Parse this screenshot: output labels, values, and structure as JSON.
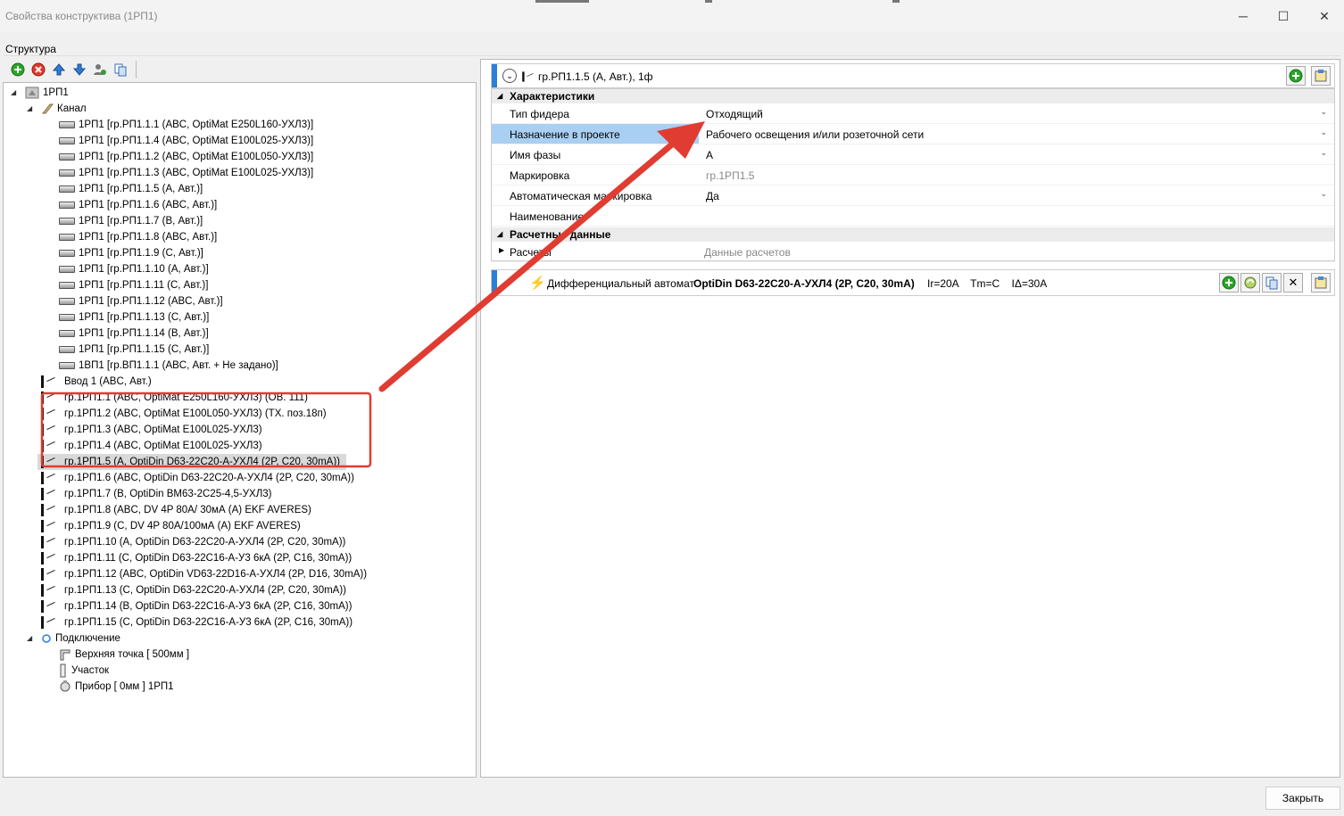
{
  "window": {
    "title": "Свойства конструктива (1РП1)",
    "controls": [
      "─",
      "☐",
      "✕"
    ]
  },
  "structure_label": "Структура",
  "toolbar": {
    "icons": [
      "add-icon",
      "delete-icon",
      "move-up-icon",
      "move-down-icon",
      "user-settings-icon",
      "copy-icon"
    ]
  },
  "tree": {
    "root": "1РП1",
    "channel": "Канал",
    "channel_items": [
      "1РП1 [гр.РП1.1.1 (ABC, OptiMat E250L160-УХЛ3)]",
      "1РП1 [гр.РП1.1.4 (ABC, OptiMat E100L025-УХЛ3)]",
      "1РП1 [гр.РП1.1.2 (ABC, OptiMat E100L050-УХЛ3)]",
      "1РП1 [гр.РП1.1.3 (ABC, OptiMat E100L025-УХЛ3)]",
      "1РП1 [гр.РП1.1.5 (A, Авт.)]",
      "1РП1 [гр.РП1.1.6 (ABC, Авт.)]",
      "1РП1 [гр.РП1.1.7 (B, Авт.)]",
      "1РП1 [гр.РП1.1.8 (ABC, Авт.)]",
      "1РП1 [гр.РП1.1.9 (C, Авт.)]",
      "1РП1 [гр.РП1.1.10 (A, Авт.)]",
      "1РП1 [гр.РП1.1.11 (C, Авт.)]",
      "1РП1 [гр.РП1.1.12 (ABC, Авт.)]",
      "1РП1 [гр.РП1.1.13 (C, Авт.)]",
      "1РП1 [гр.РП1.1.14 (B, Авт.)]",
      "1РП1 [гр.РП1.1.15 (C, Авт.)]",
      "1ВП1 [гр.ВП1.1.1 (ABC, Авт. + Не задано)]"
    ],
    "devices": [
      "Ввод 1 (ABC, Авт.)",
      "гр.1РП1.1 (ABC, OptiMat E250L160-УХЛ3)   (ОВ. 111)",
      "гр.1РП1.2 (ABC, OptiMat E100L050-УХЛ3)   (ТХ. поз.18п)",
      "гр.1РП1.3 (ABC, OptiMat E100L025-УХЛ3)",
      "гр.1РП1.4 (ABC, OptiMat E100L025-УХЛ3)",
      "гр.1РП1.5 (A, OptiDin D63-22C20-A-УХЛ4 (2P, C20, 30mA))",
      "гр.1РП1.6 (ABC, OptiDin D63-22C20-A-УХЛ4 (2P, C20, 30mA))",
      "гр.1РП1.7 (B, OptiDin BM63-2C25-4,5-УХЛ3)",
      "гр.1РП1.8 (ABC, DV 4P  80A/ 30мА (A) EKF AVERES)",
      "гр.1РП1.9 (C, DV 4P  80A/100мА (A) EKF AVERES)",
      "гр.1РП1.10 (A, OptiDin D63-22C20-A-УХЛ4 (2P, C20, 30mA))",
      "гр.1РП1.11 (C, OptiDin D63-22C16-A-У3 6кА  (2P, C16, 30mA))",
      "гр.1РП1.12 (ABC, OptiDin VD63-22D16-A-УХЛ4 (2P, D16, 30mA))",
      "гр.1РП1.13 (C, OptiDin D63-22C20-A-УХЛ4 (2P, C20, 30mA))",
      "гр.1РП1.14 (B, OptiDin D63-22C16-A-У3 6кА  (2P, C16, 30mA))",
      "гр.1РП1.15 (C, OptiDin D63-22C16-A-У3 6кА  (2P, C16, 30mA))"
    ],
    "connection": "Подключение",
    "connection_items": [
      "Верхняя точка [ 500мм ]",
      "Участок",
      "Прибор [ 0мм ] 1РП1"
    ]
  },
  "right": {
    "header_title": "гр.РП1.1.5 (A, Авт.), 1ф",
    "cat_characteristics": "Характеристики",
    "props": [
      {
        "key": "Тип фидера",
        "value": "Отходящий"
      },
      {
        "key": "Назначение в проекте",
        "value": "Рабочего освещения и/или розеточной сети"
      },
      {
        "key": "Имя фазы",
        "value": "A"
      },
      {
        "key": "Маркировка",
        "value": "гр.1РП1.5"
      },
      {
        "key": "Автоматическая маркировка",
        "value": "Да"
      },
      {
        "key": "Наименование",
        "value": ""
      }
    ],
    "cat_calc": "Расчетные данные",
    "calc_key": "Расчеты",
    "calc_value": "Данные расчетов",
    "device_prefix": "Дифференциальный автомат",
    "device_name": "OptiDin D63-22C20-A-УХЛ4 (2P, C20, 30mA)",
    "device_params": "Ir=20A    Tm=C    IΔ=30A"
  },
  "close_button": "Закрыть",
  "colors": {
    "highlight_blue": "#a9cff2",
    "annotation_red": "#e03c31",
    "accent_blue": "#2b7fd6"
  }
}
